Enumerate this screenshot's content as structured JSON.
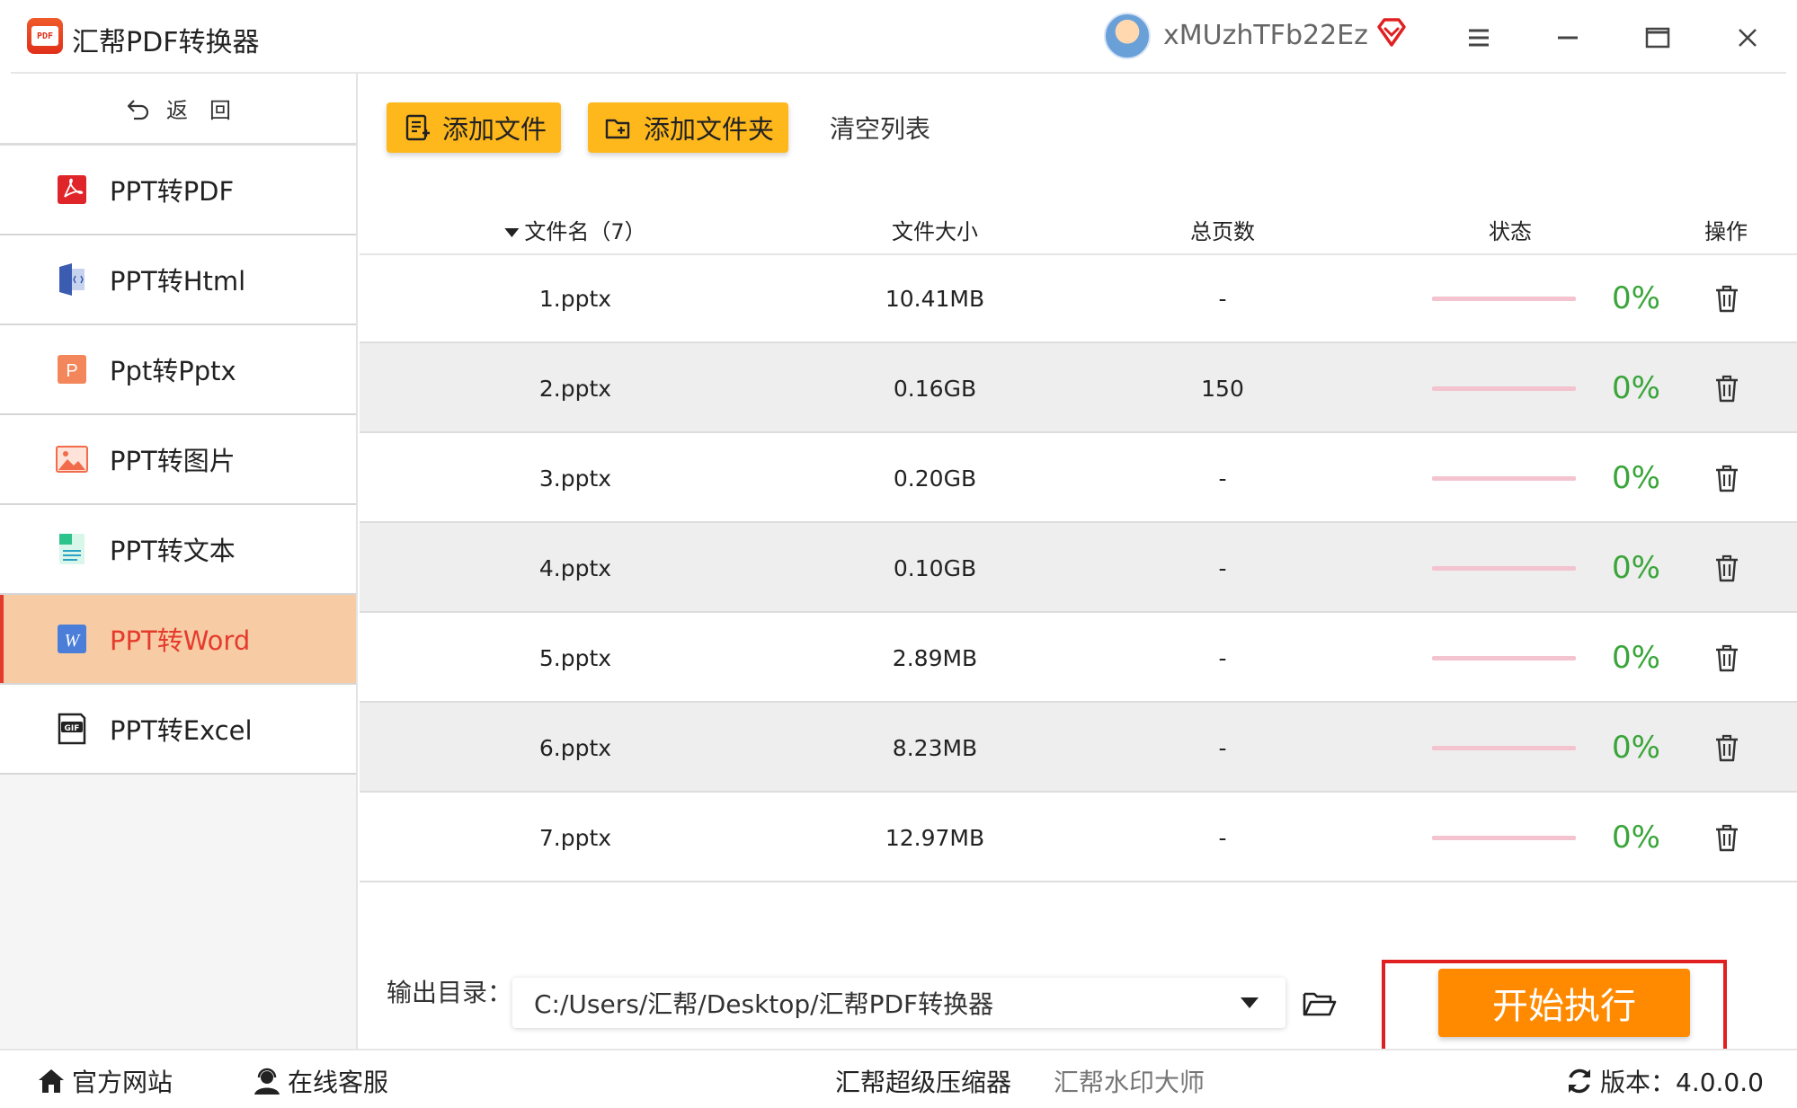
{
  "app": {
    "title": "汇帮PDF转换器",
    "logo_text": "PDF",
    "username": "xMUzhTFb22Ez"
  },
  "sidebar": {
    "back_label": "返　回",
    "items": [
      {
        "label": "PPT转PDF",
        "icon": "pdf-icon",
        "active": false
      },
      {
        "label": "PPT转Html",
        "icon": "html-icon",
        "active": false
      },
      {
        "label": "Ppt转Pptx",
        "icon": "pptx-icon",
        "active": false
      },
      {
        "label": "PPT转图片",
        "icon": "image-icon",
        "active": false
      },
      {
        "label": "PPT转文本",
        "icon": "text-icon",
        "active": false
      },
      {
        "label": "PPT转Word",
        "icon": "word-icon",
        "active": true
      },
      {
        "label": "PPT转Excel",
        "icon": "excel-icon",
        "active": false
      }
    ]
  },
  "toolbar": {
    "add_file_label": "添加文件",
    "add_folder_label": "添加文件夹",
    "clear_label": "清空列表"
  },
  "table": {
    "headers": {
      "name": "文件名（7）",
      "size": "文件大小",
      "pages": "总页数",
      "status": "状态",
      "action": "操作"
    },
    "rows": [
      {
        "name": "1.pptx",
        "size": "10.41MB",
        "pages": "-",
        "progress": 0,
        "percent": "0%"
      },
      {
        "name": "2.pptx",
        "size": "0.16GB",
        "pages": "150",
        "progress": 0,
        "percent": "0%"
      },
      {
        "name": "3.pptx",
        "size": "0.20GB",
        "pages": "-",
        "progress": 0,
        "percent": "0%"
      },
      {
        "name": "4.pptx",
        "size": "0.10GB",
        "pages": "-",
        "progress": 0,
        "percent": "0%"
      },
      {
        "name": "5.pptx",
        "size": "2.89MB",
        "pages": "-",
        "progress": 0,
        "percent": "0%"
      },
      {
        "name": "6.pptx",
        "size": "8.23MB",
        "pages": "-",
        "progress": 0,
        "percent": "0%"
      },
      {
        "name": "7.pptx",
        "size": "12.97MB",
        "pages": "-",
        "progress": 0,
        "percent": "0%"
      }
    ]
  },
  "output": {
    "label": "输出目录：",
    "path": "C:/Users/汇帮/Desktop/汇帮PDF转换器"
  },
  "start_label": "开始执行",
  "footer": {
    "website": "官方网站",
    "support": "在线客服",
    "compressor": "汇帮超级压缩器",
    "watermark": "汇帮水印大师",
    "version": "版本：4.0.0.0"
  },
  "colors": {
    "accent_orange": "#ff8a00",
    "button_yellow": "#ffb81c",
    "active_nav_bg": "#f7cba4",
    "active_nav_text": "#e53b2d",
    "percent_green": "#3aa53a",
    "highlight_red": "#e02020"
  }
}
